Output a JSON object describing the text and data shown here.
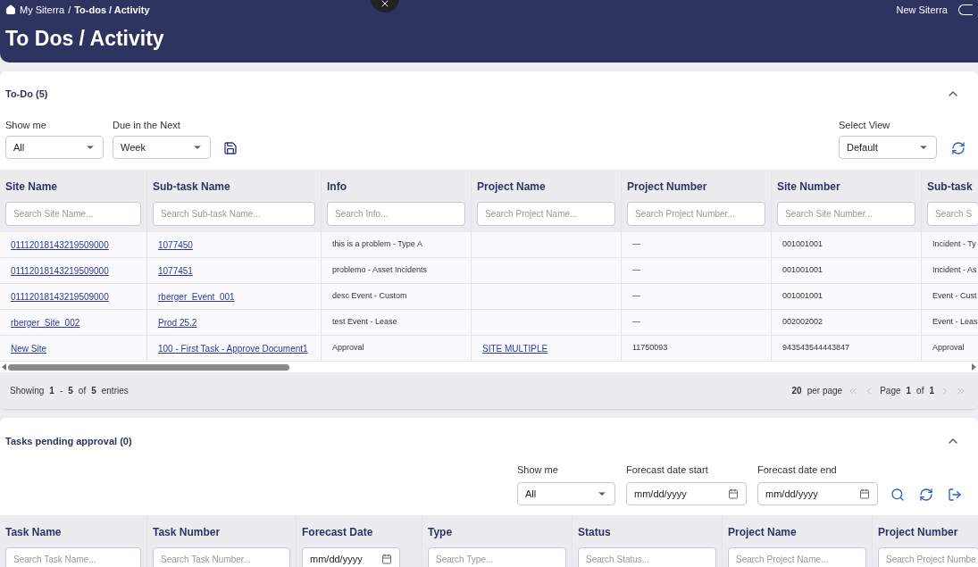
{
  "header": {
    "breadcrumb": [
      {
        "label": "My Siterra",
        "current": false
      },
      {
        "label": "To-dos / Activity",
        "current": true
      }
    ],
    "separator": "/",
    "title": "To Dos / Activity",
    "account": "New Siterra",
    "toggle_on": false
  },
  "todo": {
    "title": "To-Do (5)",
    "expanded": true,
    "filters": [
      {
        "label": "Show me",
        "value": "All"
      },
      {
        "label": "Due in the Next",
        "value": "Week"
      }
    ],
    "select_view": {
      "label": "Select View",
      "value": "Default"
    },
    "columns": [
      {
        "label": "Site Name",
        "placeholder": "Search Site Name..."
      },
      {
        "label": "Sub-task Name",
        "placeholder": "Search Sub-task Name..."
      },
      {
        "label": "Info",
        "placeholder": "Search Info..."
      },
      {
        "label": "Project Name",
        "placeholder": "Search Project Name..."
      },
      {
        "label": "Project Number",
        "placeholder": "Search Project Number..."
      },
      {
        "label": "Site Number",
        "placeholder": "Search Site Number..."
      },
      {
        "label": "Sub-task",
        "placeholder": "Search S"
      }
    ],
    "rows": [
      {
        "cells": [
          {
            "text": "01112018143219509000",
            "link": true
          },
          {
            "text": "1077450",
            "link": true
          },
          {
            "text": "this is a problem - Type A",
            "link": false
          },
          null,
          {
            "text": "—",
            "link": false
          },
          {
            "text": "001001001",
            "link": false
          },
          {
            "text": "Incident - Ty",
            "link": false
          }
        ]
      },
      {
        "cells": [
          {
            "text": "01112018143219509000",
            "link": true
          },
          {
            "text": "1077451",
            "link": true
          },
          {
            "text": "problemo - Asset Incidents",
            "link": false
          },
          null,
          {
            "text": "—",
            "link": false
          },
          {
            "text": "001001001",
            "link": false
          },
          {
            "text": "Incident - As",
            "link": false
          }
        ]
      },
      {
        "cells": [
          {
            "text": "01112018143219509000",
            "link": true
          },
          {
            "text": "rberger_Event_001",
            "link": true
          },
          {
            "text": "desc Event - Custom",
            "link": false
          },
          null,
          {
            "text": "—",
            "link": false
          },
          {
            "text": "001001001",
            "link": false
          },
          {
            "text": "Event - Cust",
            "link": false
          }
        ]
      },
      {
        "cells": [
          {
            "text": "rberger_Site_002",
            "link": true
          },
          {
            "text": "Prod 25.2",
            "link": true
          },
          {
            "text": "test Event - Lease",
            "link": false
          },
          null,
          {
            "text": "—",
            "link": false
          },
          {
            "text": "002002002",
            "link": false
          },
          {
            "text": "Event - Leas",
            "link": false
          }
        ]
      },
      {
        "cells": [
          {
            "text": "New Site",
            "link": true
          },
          {
            "text": "100 - First Task - Approve Document1",
            "link": true
          },
          {
            "text": "Approval",
            "link": false
          },
          {
            "text": "SITE MULTIPLE",
            "link": true
          },
          {
            "text": "11750093",
            "link": false
          },
          {
            "text": "943543544443847",
            "link": false
          },
          {
            "text": "Approval",
            "link": false
          }
        ]
      }
    ],
    "footer": {
      "showing": "Showing",
      "from": "1",
      "dash": "-",
      "to": "5",
      "of": "of",
      "total": "5",
      "entries": "entries",
      "per_page_count": "20",
      "per_page": "per page",
      "page": "Page",
      "page_current": "1",
      "page_of": "of",
      "page_total": "1"
    }
  },
  "approval": {
    "title": "Tasks pending approval (0)",
    "expanded": true,
    "filters": [
      {
        "label": "Show me",
        "value": "All",
        "kind": "select"
      },
      {
        "label": "Forecast date start",
        "value": "mm/dd/yyyy",
        "kind": "date"
      },
      {
        "label": "Forecast date end",
        "value": "mm/dd/yyyy",
        "kind": "date"
      }
    ],
    "columns": [
      {
        "label": "Task Name",
        "placeholder": "Search Task Name...",
        "kind": "text"
      },
      {
        "label": "Task Number",
        "placeholder": "Search Task Number...",
        "kind": "text"
      },
      {
        "label": "Forecast Date",
        "placeholder": "mm/dd/yyyy",
        "kind": "date"
      },
      {
        "label": "Type",
        "placeholder": "Search Type...",
        "kind": "text"
      },
      {
        "label": "Status",
        "placeholder": "Search Status...",
        "kind": "text"
      },
      {
        "label": "Project Name",
        "placeholder": "Search Project Name...",
        "kind": "text"
      },
      {
        "label": "Project Number",
        "placeholder": "Search Project Numbe",
        "kind": "text"
      }
    ]
  }
}
